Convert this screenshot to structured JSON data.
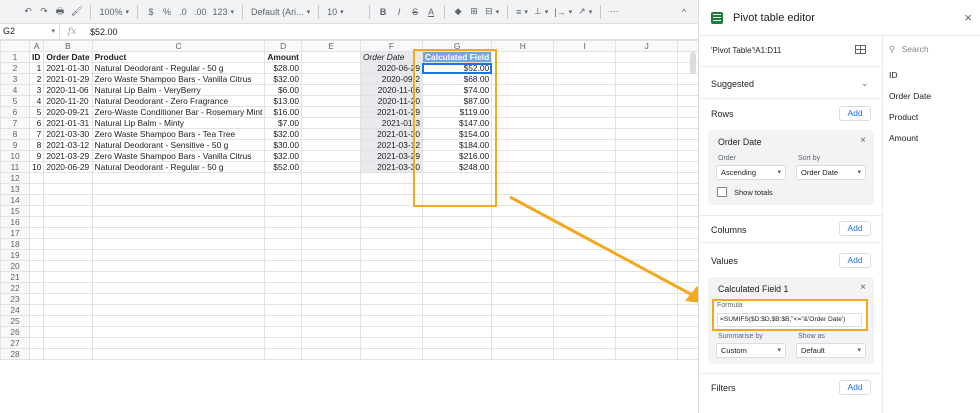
{
  "toolbar": {
    "undo": "↶",
    "redo": "↷",
    "print": "🖶",
    "paint_format": "🖌",
    "zoom": "100%",
    "currency": "$",
    "percent": "%",
    "dec_decrease": ".0",
    "dec_increase": ".00",
    "more_formats": "123",
    "font": "Default (Ari...",
    "font_size": "10",
    "bold": "B",
    "italic": "I",
    "strike": "S",
    "text_color": "A",
    "fill": "◆",
    "borders": "⊞",
    "merge": "⊟",
    "halign": "≡",
    "valign": "⊥",
    "wrap": "|→",
    "rotate": "↗",
    "more": "⋯",
    "collapse": "^"
  },
  "formula_bar": {
    "cell": "G2",
    "fx": "fx",
    "value": "$52.00"
  },
  "columns": [
    "A",
    "B",
    "C",
    "D",
    "E",
    "F",
    "G",
    "H",
    "I",
    "J"
  ],
  "headers": {
    "A": "ID",
    "B": "Order Date",
    "C": "Product",
    "D": "Amount",
    "F": "Order Date",
    "G": "Calculated Field"
  },
  "data_rows": [
    [
      "1",
      "2021-01-30",
      "Natural Deodorant - Regular - 50 g",
      "$28.00"
    ],
    [
      "2",
      "2021-01-29",
      "Zero Waste Shampoo Bars - Vanilla Citrus",
      "$32.00"
    ],
    [
      "3",
      "2020-11-06",
      "Natural Lip Balm - VeryBerry",
      "$6.00"
    ],
    [
      "4",
      "2020-11-20",
      "Natural Deodorant - Zero Fragrance",
      "$13.00"
    ],
    [
      "5",
      "2020-09-21",
      "Zero-Waste Conditioner Bar - Rosemary Mint",
      "$16.00"
    ],
    [
      "6",
      "2021-01-31",
      "Natural Lip Balm - Minty",
      "$7.00"
    ],
    [
      "7",
      "2021-03-30",
      "Zero Waste Shampoo Bars - Tea Tree",
      "$32.00"
    ],
    [
      "8",
      "2021-03-12",
      "Natural Deodorant - Sensitive - 50 g",
      "$30.00"
    ],
    [
      "9",
      "2021-03-29",
      "Zero Waste Shampoo Bars - Vanilla Citrus",
      "$32.00"
    ],
    [
      "10",
      "2020-06-29",
      "Natural Deodorant - Regular - 50 g",
      "$52.00"
    ]
  ],
  "pivot_rows": [
    [
      "2020-06-29",
      "$52.00"
    ],
    [
      "2020-09-2",
      "$68.00"
    ],
    [
      "2020-11-06",
      "$74.00"
    ],
    [
      "2020-11-20",
      "$87.00"
    ],
    [
      "2021-01-29",
      "$119.00"
    ],
    [
      "2021-01-3",
      "$147.00"
    ],
    [
      "2021-01-30",
      "$154.00"
    ],
    [
      "2021-03-12",
      "$184.00"
    ],
    [
      "2021-03-29",
      "$216.00"
    ],
    [
      "2021-03-30",
      "$248.00"
    ]
  ],
  "row_numbers": [
    "1",
    "2",
    "3",
    "4",
    "5",
    "6",
    "7",
    "8",
    "9",
    "10",
    "11",
    "12",
    "13",
    "14",
    "15",
    "16",
    "17",
    "18",
    "19",
    "20",
    "21",
    "22",
    "23",
    "24",
    "25",
    "26",
    "27",
    "28"
  ],
  "panel": {
    "title": "Pivot table editor",
    "close": "×",
    "range": "'Pivot Table'!A1:D11",
    "suggested": "Suggested",
    "rows": "Rows",
    "add": "Add",
    "rows_card": {
      "title": "Order Date",
      "close": "×",
      "order_label": "Order",
      "order_value": "Ascending",
      "sortby_label": "Sort by",
      "sortby_value": "Order Date",
      "show_totals": "Show totals"
    },
    "columns": "Columns",
    "values": "Values",
    "values_card": {
      "title": "Calculated Field 1",
      "close": "×",
      "formula_label": "Formula",
      "formula": "=SUMIFS($D:$D,$B:$B,\"<=\"&'Order Date')",
      "summarise_label": "Summarise by",
      "summarise_value": "Custom",
      "showas_label": "Show as",
      "showas_value": "Default"
    },
    "filters": "Filters",
    "search": "Search",
    "fields": [
      "ID",
      "Order Date",
      "Product",
      "Amount"
    ]
  },
  "colors": {
    "highlight": "#f4a81d",
    "calc_header": "#76a5d6",
    "sheets_green": "#188038",
    "add_blue": "#1a73e8"
  }
}
